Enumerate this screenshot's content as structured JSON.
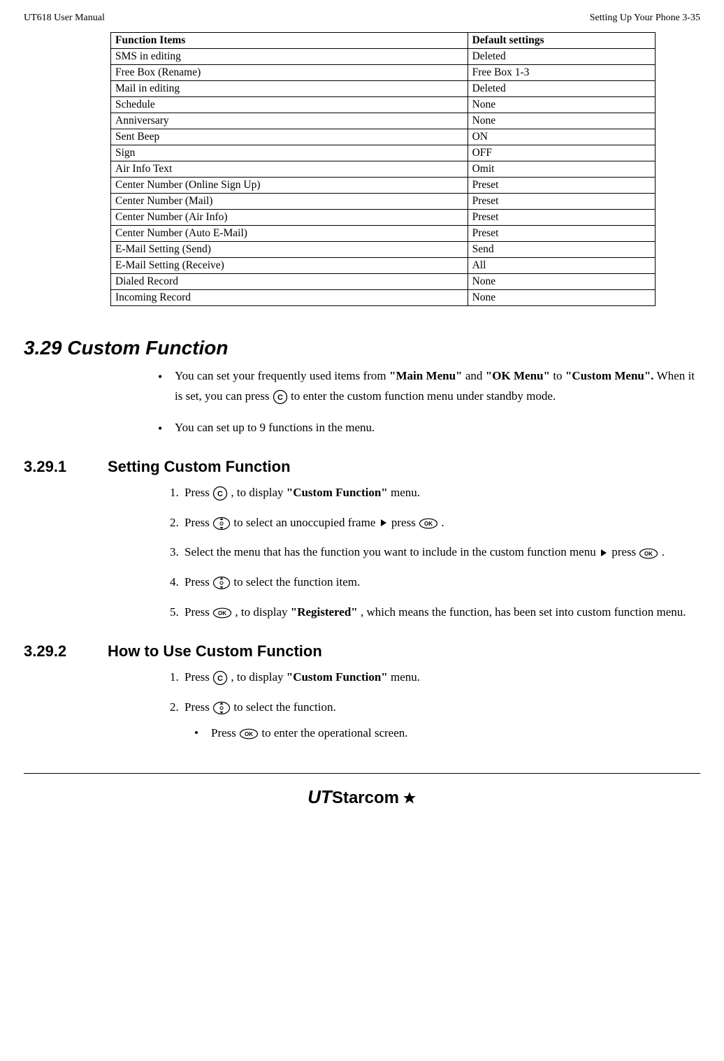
{
  "header": {
    "left": "UT618 User Manual",
    "right": "Setting Up Your Phone   3-35"
  },
  "table": {
    "headers": [
      "Function Items",
      "Default settings"
    ],
    "rows": [
      [
        "SMS in editing",
        "Deleted"
      ],
      [
        "Free Box (Rename)",
        "Free Box 1-3"
      ],
      [
        "Mail in editing",
        "Deleted"
      ],
      [
        "Schedule",
        "None"
      ],
      [
        "Anniversary",
        "None"
      ],
      [
        "Sent Beep",
        "ON"
      ],
      [
        "Sign",
        "OFF"
      ],
      [
        "Air Info Text",
        "Omit"
      ],
      [
        "Center Number (Online Sign Up)",
        "Preset"
      ],
      [
        "Center Number (Mail)",
        "Preset"
      ],
      [
        "Center Number (Air Info)",
        "Preset"
      ],
      [
        "Center Number (Auto E-Mail)",
        "Preset"
      ],
      [
        "E-Mail Setting (Send)",
        "Send"
      ],
      [
        "E-Mail Setting (Receive)",
        "All"
      ],
      [
        "Dialed Record",
        "None"
      ],
      [
        "Incoming Record",
        "None"
      ]
    ]
  },
  "sec329": {
    "title": "3.29 Custom Function",
    "bullets": {
      "b0_pre": "You can set your frequently used items from ",
      "b0_q1": "\"Main Menu\"",
      "b0_mid1": " and ",
      "b0_q2": "\"OK Menu\"",
      "b0_mid2": " to ",
      "b0_q3": "\"Custom Menu\".",
      "b0_mid3": " When it is set, you can press ",
      "b0_post": " to enter the custom function menu under standby mode.",
      "b1": "You can set up to 9 functions in the menu."
    }
  },
  "sec3291": {
    "num": "3.29.1",
    "title": "Setting Custom Function",
    "step1_a": "Press ",
    "step1_b": ", to display ",
    "step1_q": "\"Custom Function\"",
    "step1_c": " menu.",
    "step2_a": "Press ",
    "step2_b": " to select an unoccupied frame ",
    "step2_c": " press ",
    "step2_d": ".",
    "step3_a": "Select the menu that has the function you want to include in the custom function menu ",
    "step3_b": " press ",
    "step3_c": ".",
    "step4_a": "Press ",
    "step4_b": " to select the function item.",
    "step5_a": "Press ",
    "step5_b": ", to display ",
    "step5_q": "\"Registered\"",
    "step5_c": ", which means the function, has been set into custom function menu."
  },
  "sec3292": {
    "num": "3.29.2",
    "title": "How to Use Custom Function",
    "step1_a": "Press ",
    "step1_b": ", to display ",
    "step1_q": "\"Custom Function\"",
    "step1_c": " menu.",
    "step2_a": "Press ",
    "step2_b": " to select the function.",
    "sub_a": "Press ",
    "sub_b": " to enter the operational screen."
  },
  "footer": {
    "brand_ut": "UT",
    "brand_starcom": "Starcom"
  }
}
